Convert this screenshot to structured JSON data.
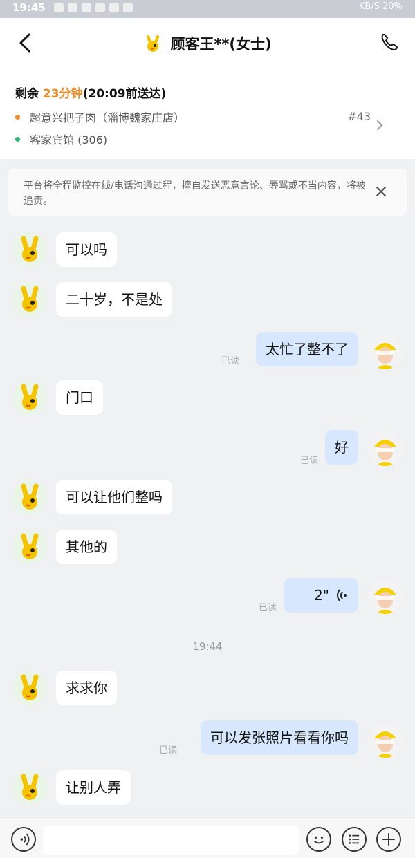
{
  "status_bar": {
    "time": "19:45",
    "network": "KB/S",
    "battery": "20%"
  },
  "header": {
    "title": "顾客王**(女士)",
    "back_icon": "chevron-left-icon",
    "phone_icon": "phone-icon"
  },
  "order": {
    "eta_prefix": "剩余 ",
    "eta_minutes": "23分钟",
    "eta_suffix": "(20:09前送达)",
    "shop": "超意兴把子肉（淄博魏家庄店）",
    "address": "客家宾馆 (306)",
    "order_number": "#43",
    "shop_dot_color": "#f08a24",
    "address_dot_color": "#2bb673"
  },
  "notice": {
    "text": "平台将全程监控在线/电话沟通过程，擅自发送恶意言论、辱骂或不当内容，将被追责。"
  },
  "messages": [
    {
      "side": "in",
      "text": "可以吗"
    },
    {
      "side": "in",
      "text": "二十岁，不是处"
    },
    {
      "side": "out",
      "text": "太忙了整不了",
      "status": "已读"
    },
    {
      "side": "in",
      "text": "门口"
    },
    {
      "side": "out",
      "text": "好",
      "status": "已读"
    },
    {
      "side": "in",
      "text": "可以让他们整吗"
    },
    {
      "side": "in",
      "text": "其他的"
    },
    {
      "side": "out",
      "type": "voice",
      "text": "2\"",
      "status": "已读"
    },
    {
      "type": "time",
      "text": "19:44"
    },
    {
      "side": "in",
      "text": "求求你"
    },
    {
      "side": "out",
      "text": "可以发张照片看看你吗",
      "status": "已读"
    },
    {
      "side": "in",
      "text": "让别人弄"
    }
  ],
  "input_bar": {
    "voice_icon": "voice-icon",
    "emoji_icon": "emoji-icon",
    "quick_reply_icon": "list-icon",
    "more_icon": "plus-icon"
  }
}
